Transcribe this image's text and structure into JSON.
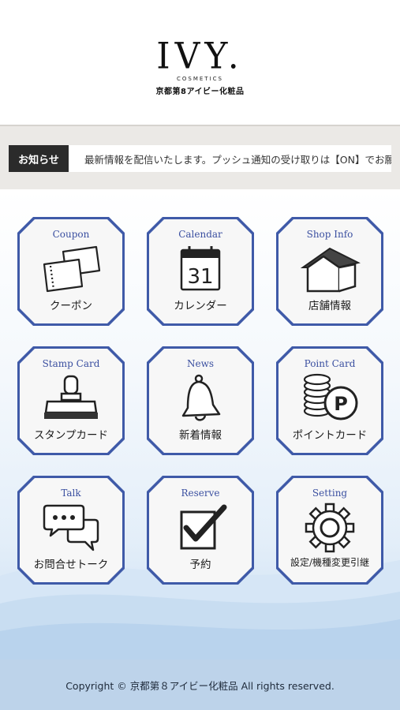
{
  "header": {
    "logo_main": "IVY.",
    "logo_sub": "COSMETICS",
    "logo_jp": "京都第8アイビー化粧品"
  },
  "news": {
    "label": "お知らせ",
    "text": "最新情報を配信いたします。プッシュ通知の受け取りは【ON】でお願いします。"
  },
  "menu": [
    {
      "en": "Coupon",
      "jp": "クーポン",
      "icon": "coupon-icon"
    },
    {
      "en": "Calendar",
      "jp": "カレンダー",
      "icon": "calendar-icon",
      "calendar_day": "31"
    },
    {
      "en": "Shop Info",
      "jp": "店舗情報",
      "icon": "house-icon"
    },
    {
      "en": "Stamp Card",
      "jp": "スタンプカード",
      "icon": "stamp-icon"
    },
    {
      "en": "News",
      "jp": "新着情報",
      "icon": "bell-icon"
    },
    {
      "en": "Point Card",
      "jp": "ポイントカード",
      "icon": "coins-point-icon",
      "point_letter": "P"
    },
    {
      "en": "Talk",
      "jp": "お問合せトーク",
      "icon": "chat-bubbles-icon"
    },
    {
      "en": "Reserve",
      "jp": "予約",
      "icon": "checkbox-icon"
    },
    {
      "en": "Setting",
      "jp": "設定/機種変更引継",
      "icon": "gear-icon"
    }
  ],
  "footer": {
    "copyright": "Copyright © 京都第８アイビー化粧品 All rights reserved."
  },
  "colors": {
    "tile_border": "#3f5aa8",
    "tile_title": "#3a4fa0",
    "news_label_bg": "#2b2b2b"
  }
}
